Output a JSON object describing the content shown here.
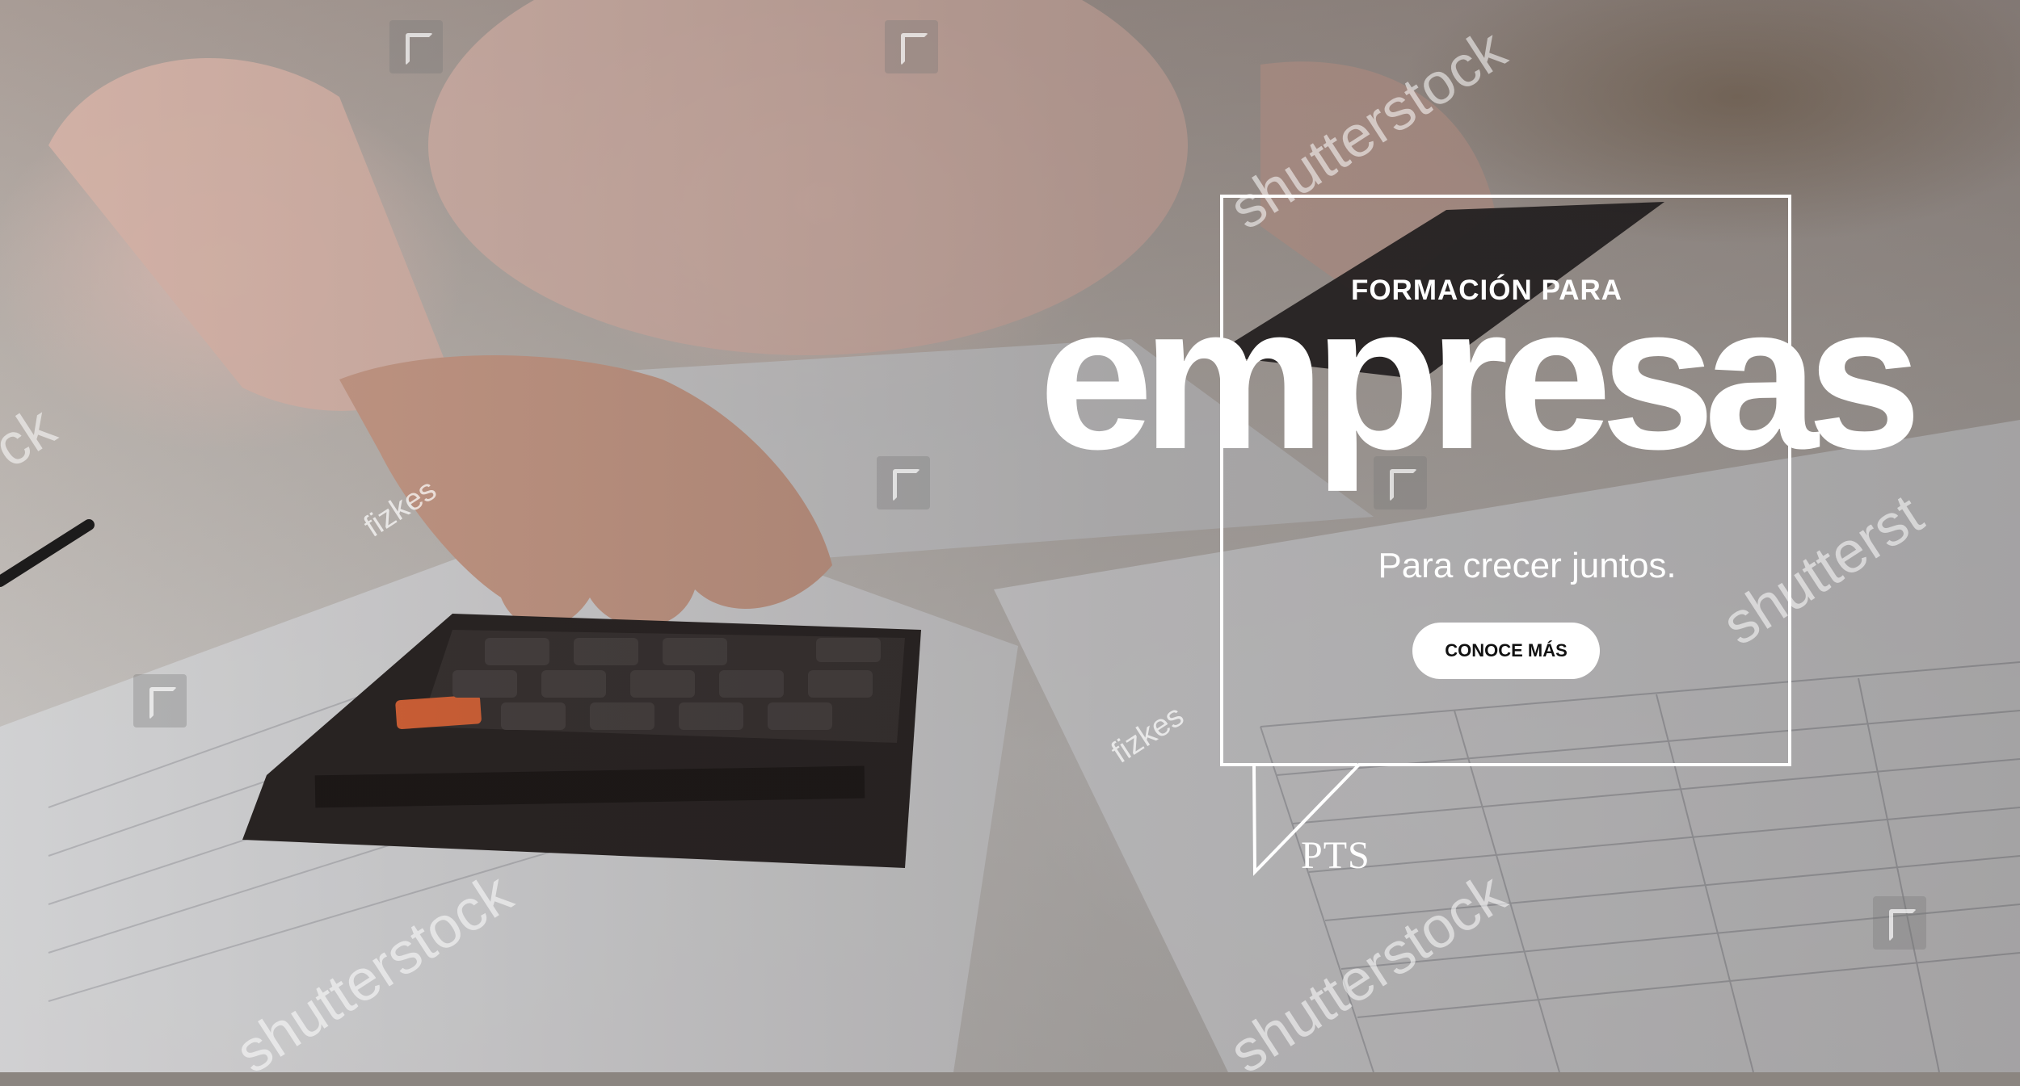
{
  "banner": {
    "eyebrow": "FORMACIÓN PARA",
    "headline": "empresas",
    "tagline": "Para crecer juntos.",
    "cta_label": "CONOCE MÁS",
    "logo_text": "PTS"
  },
  "watermarks": {
    "brand": "shutterstock",
    "brand_partial_left": "ck",
    "brand_partial_right": "shutterst",
    "photographer": "fizkes"
  },
  "colors": {
    "overlay_text": "#ffffff",
    "button_bg": "#ffffff",
    "button_text": "#111111",
    "calculator_body": "#2a2524",
    "calculator_on_key": "#e86a3a"
  }
}
